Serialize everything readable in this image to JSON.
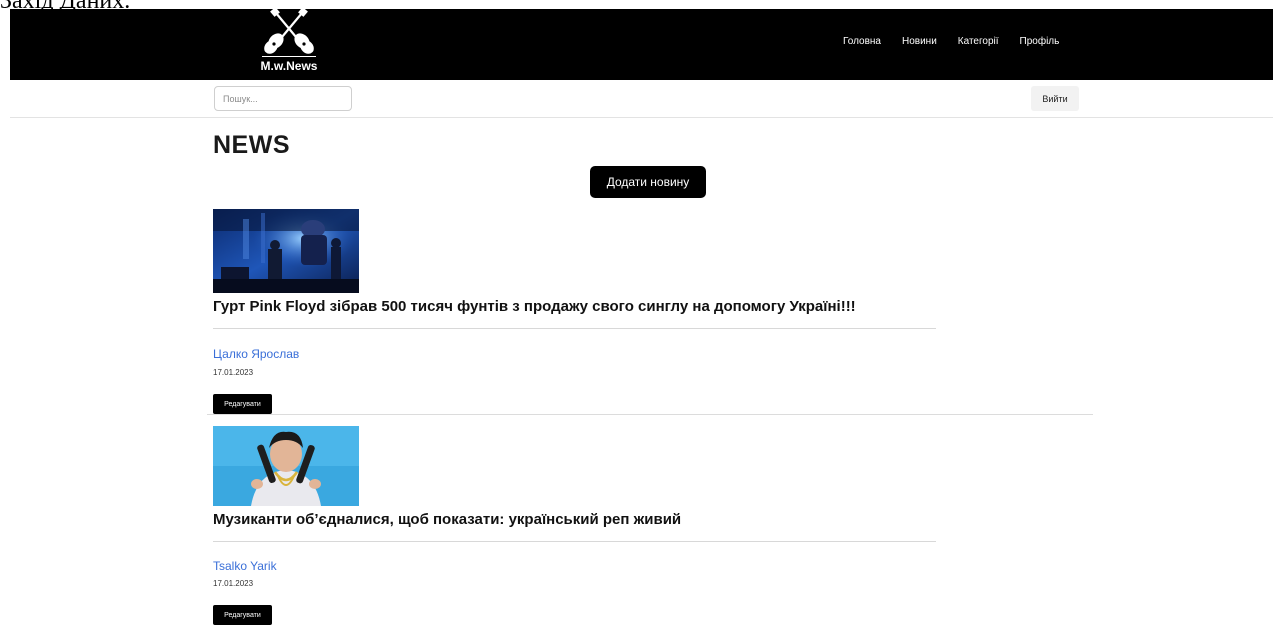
{
  "doc_caption": "Захід Даних.",
  "navbar": {
    "logo_text": "M.w.News",
    "links": [
      "Головна",
      "Новини",
      "Категорії",
      "Профіль"
    ]
  },
  "search": {
    "placeholder": "Пошук...",
    "value": ""
  },
  "logout_label": "Вийти",
  "page_title": "NEWS",
  "add_button_label": "Додати новину",
  "articles": [
    {
      "image": "concert-stage-photo",
      "title": "Гурт Pink Floyd зібрав 500 тисяч фунтів з продажу свого синглу на допомогу Україні!!!",
      "author": "Цалко Ярослав",
      "date": "17.01.2023",
      "edit_label": "Редагувати"
    },
    {
      "image": "rapper-portrait-photo",
      "title": "Музиканти об’єдналися, щоб показати: український реп живий",
      "author": "Tsalko Yarik",
      "date": "17.01.2023",
      "edit_label": "Редагувати"
    }
  ],
  "colors": {
    "navbar_bg": "#000000",
    "link_blue": "#3a6fd8",
    "button_dark": "#000000"
  }
}
